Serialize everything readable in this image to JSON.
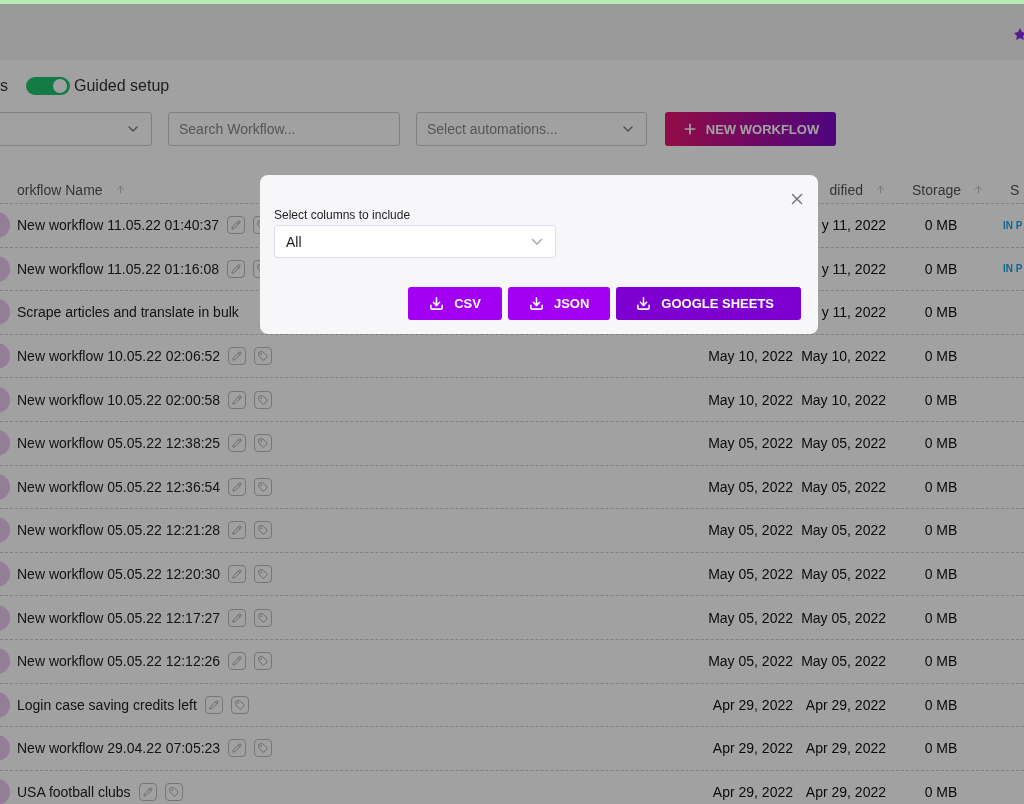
{
  "toolbar": {
    "cut_label": "s",
    "guided_setup": {
      "label": "Guided setup",
      "on": true
    },
    "search": {
      "placeholder": "Search Workflow..."
    },
    "automations": {
      "placeholder": "Select automations..."
    },
    "new_button": {
      "label": "NEW WORKFLOW"
    }
  },
  "table": {
    "header": {
      "name": "orkflow Name",
      "modified": "dified",
      "storage": "Storage",
      "status": "S"
    },
    "rows": [
      {
        "name": "New workflow 11.05.22 01:40:37",
        "actions": true,
        "modified": "y 11, 2022",
        "storage": "0 MB",
        "status": "IN P"
      },
      {
        "name": "New workflow 11.05.22 01:16:08",
        "actions": true,
        "modified": "y 11, 2022",
        "storage": "0 MB",
        "status": "IN P"
      },
      {
        "name": "Scrape articles and translate in bulk",
        "actions": false,
        "modified": "y 11, 2022",
        "storage": "0 MB"
      },
      {
        "name": "New workflow 10.05.22 02:06:52",
        "actions": true,
        "created": "May 10, 2022",
        "modified": "May 10, 2022",
        "storage": "0 MB"
      },
      {
        "name": "New workflow 10.05.22 02:00:58",
        "actions": true,
        "created": "May 10, 2022",
        "modified": "May 10, 2022",
        "storage": "0 MB"
      },
      {
        "name": "New workflow 05.05.22 12:38:25",
        "actions": true,
        "created": "May 05, 2022",
        "modified": "May 05, 2022",
        "storage": "0 MB"
      },
      {
        "name": "New workflow 05.05.22 12:36:54",
        "actions": true,
        "created": "May 05, 2022",
        "modified": "May 05, 2022",
        "storage": "0 MB"
      },
      {
        "name": "New workflow 05.05.22 12:21:28",
        "actions": true,
        "created": "May 05, 2022",
        "modified": "May 05, 2022",
        "storage": "0 MB"
      },
      {
        "name": "New workflow 05.05.22 12:20:30",
        "actions": true,
        "created": "May 05, 2022",
        "modified": "May 05, 2022",
        "storage": "0 MB"
      },
      {
        "name": "New workflow 05.05.22 12:17:27",
        "actions": true,
        "created": "May 05, 2022",
        "modified": "May 05, 2022",
        "storage": "0 MB"
      },
      {
        "name": "New workflow 05.05.22 12:12:26",
        "actions": true,
        "created": "May 05, 2022",
        "modified": "May 05, 2022",
        "storage": "0 MB"
      },
      {
        "name": "Login case saving credits left",
        "actions": true,
        "created": "Apr 29, 2022",
        "modified": "Apr 29, 2022",
        "storage": "0 MB"
      },
      {
        "name": "New workflow 29.04.22 07:05:23",
        "actions": true,
        "created": "Apr 29, 2022",
        "modified": "Apr 29, 2022",
        "storage": "0 MB"
      },
      {
        "name": "USA football clubs",
        "actions": true,
        "created": "Apr 29, 2022",
        "modified": "Apr 29, 2022",
        "storage": "0 MB"
      }
    ]
  },
  "modal": {
    "label": "Select columns to include",
    "value": "All",
    "buttons": [
      {
        "label": "CSV",
        "kind": "primary"
      },
      {
        "label": "JSON",
        "kind": "primary"
      },
      {
        "label": "GOOGLE SHEETS",
        "kind": "secondary"
      }
    ]
  }
}
